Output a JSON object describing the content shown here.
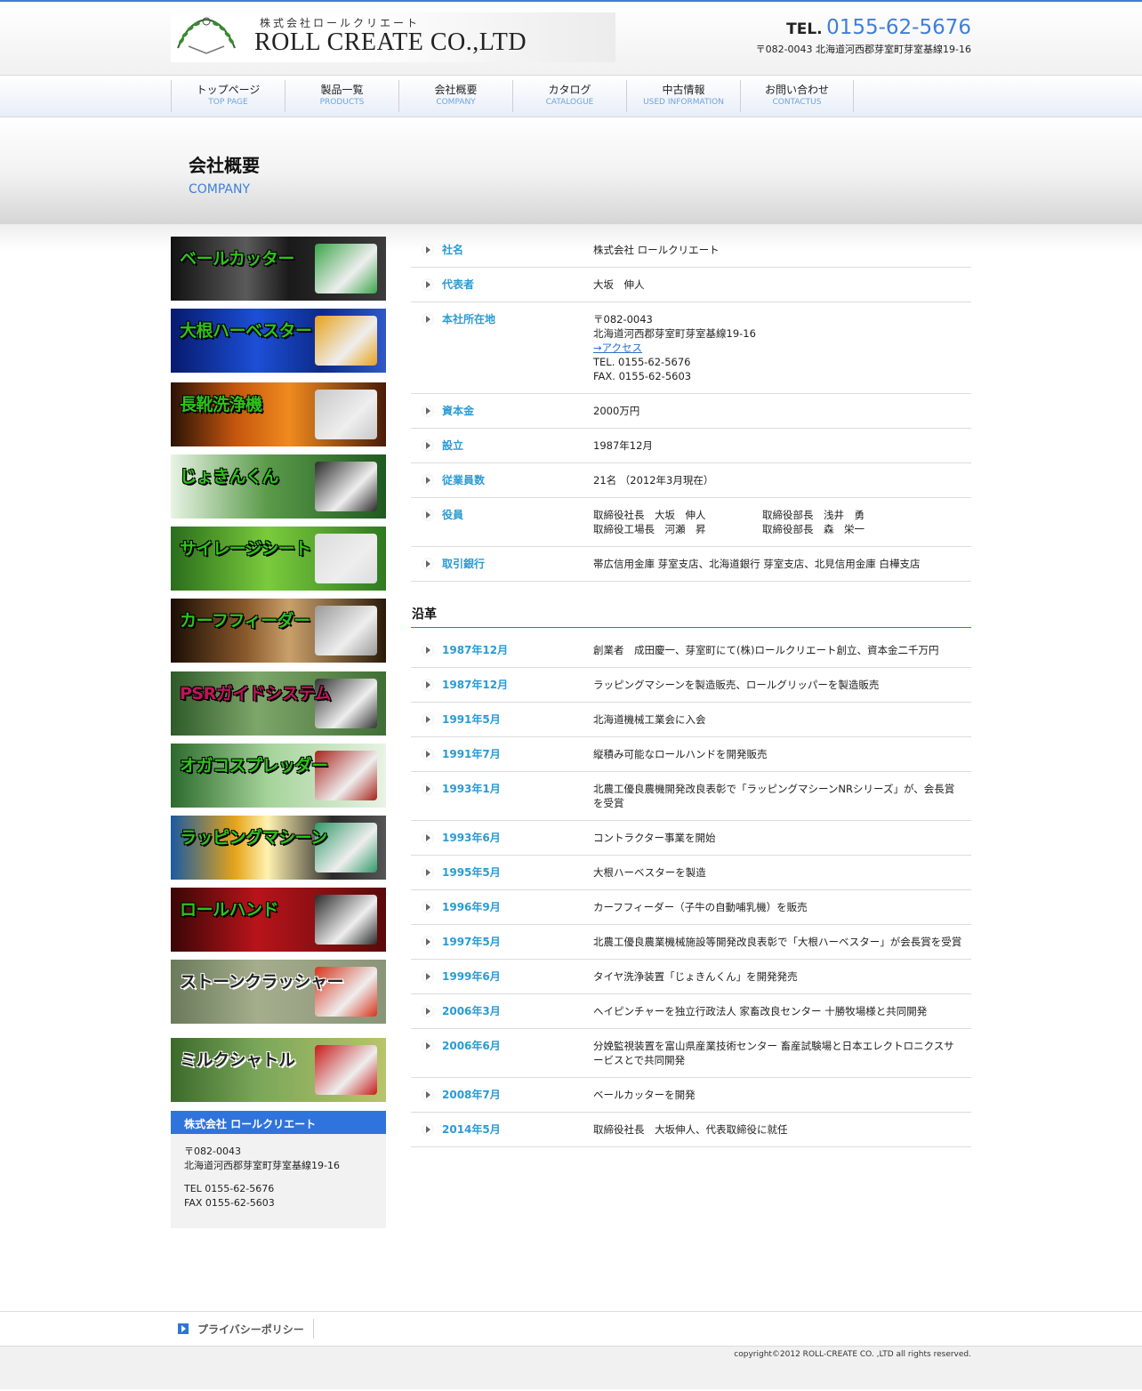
{
  "header": {
    "company_jp": "株式会社ロールクリエート",
    "company_en": "ROLL CREATE CO.,LTD",
    "tel_label": "TEL.",
    "tel_number": "0155-62-5676",
    "address": "〒082-0043 北海道河西郡芽室町芽室基線19-16"
  },
  "nav": [
    {
      "jp": "トップページ",
      "en": "TOP PAGE"
    },
    {
      "jp": "製品一覧",
      "en": "PRODUCTS"
    },
    {
      "jp": "会社概要",
      "en": "COMPANY"
    },
    {
      "jp": "カタログ",
      "en": "CATALOGUE"
    },
    {
      "jp": "中古情報",
      "en": "USED INFORMATION"
    },
    {
      "jp": "お問い合わせ",
      "en": "CONTACTUS"
    }
  ],
  "page": {
    "title": "会社概要",
    "subtitle": "COMPANY"
  },
  "sidebar": {
    "banners": [
      {
        "label": "ベールカッター",
        "bg": "linear-gradient(90deg,#111 0%,#5a5a5a 35%,#1a1a1a 55%,#3c3c3c 100%)",
        "color": "#2ec21a",
        "accent": "#3aa64a"
      },
      {
        "label": "大根ハーベスター",
        "bg": "linear-gradient(90deg,#061a6e 0%,#1d4fd6 40%,#0c2a8a 70%,#3058c8 100%)",
        "color": "#2ec21a",
        "accent": "#e8a11a"
      },
      {
        "label": "長靴洗浄機",
        "bg": "linear-gradient(90deg,#2a1206 0%,#c4560e 30%,#f08a1e 55%,#4a1c08 100%)",
        "color": "#2ec21a",
        "accent": "#c8c8c8"
      },
      {
        "label": "じょきんくん",
        "bg": "linear-gradient(90deg,#e8f3e4 0%,#5a9a4a 45%,#1f5a20 100%)",
        "color": "#2ec21a",
        "accent": "#2b2b2b"
      },
      {
        "label": "サイレージシート",
        "bg": "linear-gradient(90deg,#2a6d1c 0%,#7acb3c 45%,#2f7a20 100%)",
        "color": "#2ec21a",
        "accent": "#dcdcdc"
      },
      {
        "label": "カーフフィーダー",
        "bg": "linear-gradient(90deg,#1a0d05 0%,#8a5a2c 35%,#c9a06a 55%,#2a1a0a 100%)",
        "color": "#2ec21a",
        "accent": "#9a9a9a"
      },
      {
        "label": "PSRガイドシステム",
        "bg": "linear-gradient(90deg,#2e5a2a 0%,#7ea66a 40%,#3f6e34 100%)",
        "color": "#c0145a",
        "accent": "#333333"
      },
      {
        "label": "オガコスプレッダー",
        "bg": "linear-gradient(90deg,#2c6a2c 0%,#a5d39a 45%,#e8f3e4 100%)",
        "color": "#2ec21a",
        "accent": "#a8231a"
      },
      {
        "label": "ラッピングマシーン",
        "bg": "linear-gradient(90deg,#1a5aa0 0%,#e6a41a 30%,#fff2b0 45%,#2a2a2a 75%,#555 100%)",
        "color": "#2ec21a",
        "accent": "#2f9a6a"
      },
      {
        "label": "ロールハンド",
        "bg": "linear-gradient(90deg,#3a0606 0%,#b8141a 40%,#5a0a0a 100%)",
        "color": "#2ec21a",
        "accent": "#2a2a2a"
      },
      {
        "label": "ストーンクラッシャー",
        "bg": "linear-gradient(90deg,#6a7a5a 0%,#a4ad8c 40%,#8a9478 100%)",
        "color": "#222222",
        "accent": "#d8321a"
      },
      {
        "label": "ミルクシャトル",
        "bg": "linear-gradient(90deg,#3c6a2a 0%,#7aa65a 40%,#b9c46a 100%)",
        "color": "#222222",
        "accent": "#c81a1a"
      }
    ],
    "company_box": {
      "name": "株式会社 ロールクリエート",
      "postal": "〒082-0043",
      "address": "北海道河西郡芽室町芽室基線19-16",
      "tel": "TEL 0155-62-5676",
      "fax": "FAX 0155-62-5603"
    }
  },
  "profile": {
    "name_label": "社名",
    "name_value": "株式会社 ロールクリエート",
    "rep_label": "代表者",
    "rep_value": "大坂　伸人",
    "hq_label": "本社所在地",
    "hq_postal": "〒082-0043",
    "hq_address": "北海道河西郡芽室町芽室基線19-16",
    "hq_access": "→アクセス",
    "hq_tel": "TEL. 0155-62-5676",
    "hq_fax": "FAX. 0155-62-5603",
    "capital_label": "資本金",
    "capital_value": "2000万円",
    "founded_label": "設立",
    "founded_value": "1987年12月",
    "employees_label": "従業員数",
    "employees_value": "21名 （2012年3月現在）",
    "officers_label": "役員",
    "officers": [
      "取締役社長　大坂　伸人",
      "取締役部長　浅井　勇",
      "取締役工場長　河瀬　昇",
      "取締役部長　森　栄一"
    ],
    "bank_label": "取引銀行",
    "bank_value": "帯広信用金庫 芽室支店、北海道銀行 芽室支店、北見信用金庫 白樺支店"
  },
  "history": {
    "title": "沿革",
    "items": [
      {
        "date": "1987年12月",
        "text": "創業者　成田慶一、芽室町にて(株)ロールクリエート創立、資本金二千万円"
      },
      {
        "date": "1987年12月",
        "text": "ラッピングマシーンを製造販売、ロールグリッパーを製造販売"
      },
      {
        "date": "1991年5月",
        "text": "北海道機械工業会に入会"
      },
      {
        "date": "1991年7月",
        "text": "縦積み可能なロールハンドを開発販売"
      },
      {
        "date": "1993年1月",
        "text": "北農工優良農機開発改良表彰で「ラッピングマシーンNRシリーズ」が、会長賞を受賞"
      },
      {
        "date": "1993年6月",
        "text": "コントラクター事業を開始"
      },
      {
        "date": "1995年5月",
        "text": "大根ハーベスターを製造"
      },
      {
        "date": "1996年9月",
        "text": "カーフフィーダー（子牛の自動哺乳機）を販売"
      },
      {
        "date": "1997年5月",
        "text": "北農工優良農業機械施設等開発改良表彰で「大根ハーベスター」が会長賞を受賞"
      },
      {
        "date": "1999年6月",
        "text": "タイヤ洗浄装置「じょきんくん」を開発発売"
      },
      {
        "date": "2006年3月",
        "text": "ヘイピンチャーを独立行政法人 家畜改良センター 十勝牧場様と共同開発"
      },
      {
        "date": "2006年6月",
        "text": "分娩監視装置を富山県産業技術センター 畜産試験場と日本エレクトロニクスサービスとで共同開発"
      },
      {
        "date": "2008年7月",
        "text": "ベールカッターを開発"
      },
      {
        "date": "2014年5月",
        "text": "取締役社長　大坂伸人、代表取締役に就任"
      }
    ]
  },
  "footer": {
    "privacy": "プライバシーポリシー",
    "copyright": "copyright©2012 ROLL-CREATE CO. ,LTD all rights reserved."
  },
  "colors": {
    "accent": "#3f7fd8",
    "label": "#2a9bd4",
    "company_head": "#2f74dc"
  }
}
